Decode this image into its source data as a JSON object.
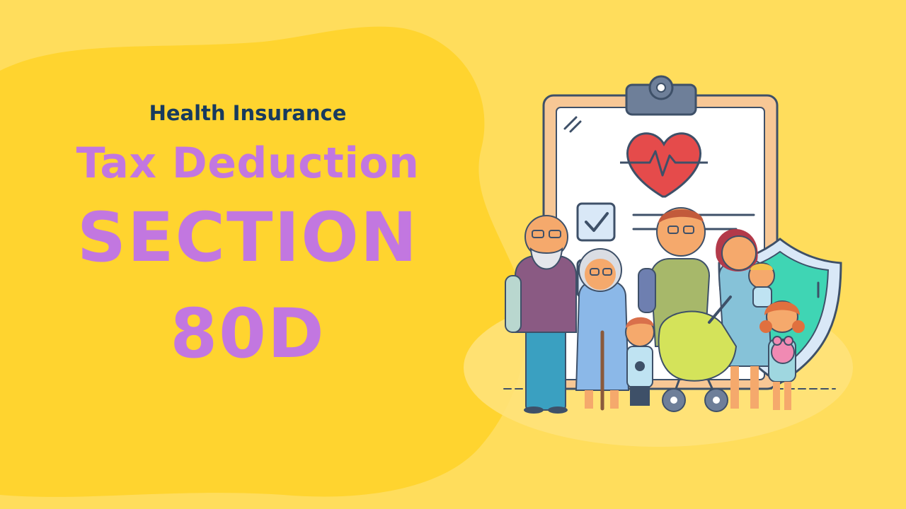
{
  "heading": {
    "subtitle": "Health Insurance",
    "title": "Tax Deduction",
    "section_label": "SECTION",
    "section_number": "80D"
  },
  "colors": {
    "background": "#FFDD5C",
    "blob": "#FFD42F",
    "subtitle_text": "#173A5E",
    "title_text": "#C277E0",
    "clipboard_frame": "#F7C795",
    "clipboard_paper": "#FFFFFF",
    "clip": "#6E7F99",
    "heart": "#E54B4B",
    "shield": "#3FD5B4",
    "outline": "#3E5068"
  },
  "illustration": {
    "icons": [
      "clipboard-icon",
      "heart-icon",
      "checkbox-icon",
      "shield-icon",
      "family-icon",
      "stroller-icon"
    ]
  }
}
